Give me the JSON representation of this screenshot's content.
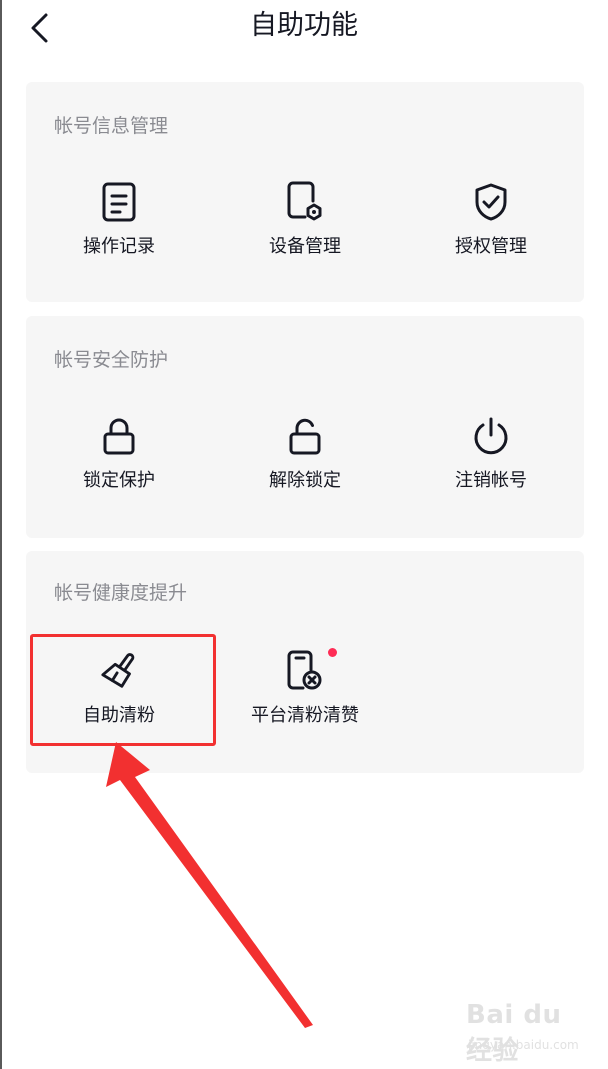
{
  "header": {
    "title": "自助功能",
    "back_icon": "chevron-left-icon"
  },
  "sections": [
    {
      "title": "帐号信息管理",
      "items": [
        {
          "label": "操作记录",
          "icon": "document-icon"
        },
        {
          "label": "设备管理",
          "icon": "device-settings-icon"
        },
        {
          "label": "授权管理",
          "icon": "shield-check-icon"
        }
      ]
    },
    {
      "title": "帐号安全防护",
      "items": [
        {
          "label": "锁定保护",
          "icon": "lock-icon"
        },
        {
          "label": "解除锁定",
          "icon": "unlock-icon"
        },
        {
          "label": "注销帐号",
          "icon": "power-icon"
        }
      ]
    },
    {
      "title": "帐号健康度提升",
      "items": [
        {
          "label": "自助清粉",
          "icon": "brush-icon"
        },
        {
          "label": "平台清粉清赞",
          "icon": "phone-remove-icon"
        }
      ]
    }
  ],
  "colors": {
    "highlight": "#f23030",
    "badge": "#fe2c55",
    "card_bg": "#f6f6f6"
  },
  "watermark": {
    "brand": "Bai du 经验",
    "url": "jingyan.baidu.com"
  }
}
